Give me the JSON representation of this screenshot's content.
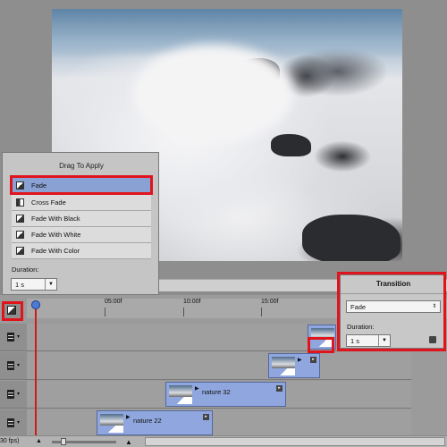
{
  "drag_panel": {
    "title": "Drag To Apply",
    "items": [
      {
        "label": "Fade",
        "selected": true
      },
      {
        "label": "Cross Fade",
        "selected": false
      },
      {
        "label": "Fade With Black",
        "selected": false
      },
      {
        "label": "Fade With White",
        "selected": false
      },
      {
        "label": "Fade With Color",
        "selected": false
      }
    ],
    "duration_label": "Duration:",
    "duration_value": "1 s"
  },
  "timeline": {
    "ruler_ticks": [
      "05:00f",
      "10:00f",
      "15:00f"
    ],
    "clips": [
      {
        "name": "nature 32"
      },
      {
        "name": "nature 22"
      }
    ],
    "fps_text": "30 fps)"
  },
  "transition_panel": {
    "title": "Transition",
    "type_value": "Fade",
    "duration_label": "Duration:",
    "duration_value": "1 s"
  },
  "colors": {
    "highlight_red": "#e0141c",
    "selection_blue": "#8aa2d3",
    "clip_blue": "#8fa7de"
  }
}
